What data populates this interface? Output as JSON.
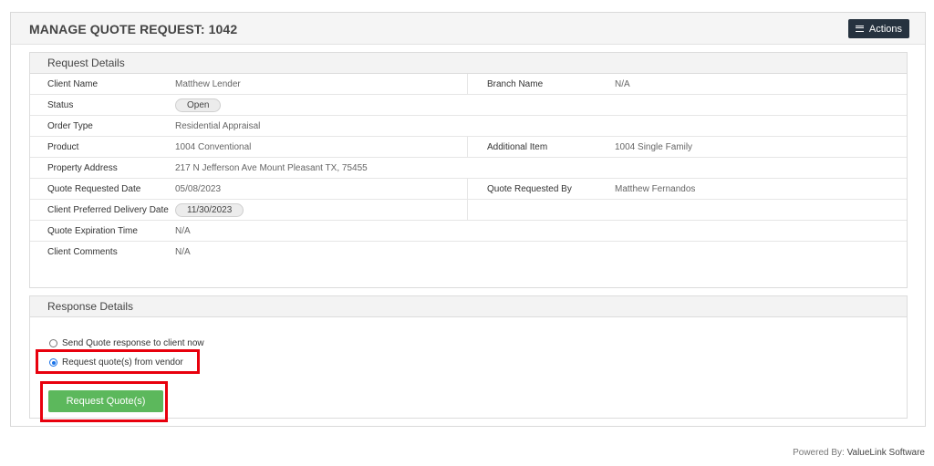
{
  "header": {
    "title": "MANAGE QUOTE REQUEST: 1042",
    "actions_label": "Actions"
  },
  "request_details": {
    "title": "Request Details",
    "rows": [
      {
        "label": "Client Name",
        "value": "Matthew Lender",
        "label2": "Branch Name",
        "value2": "N/A"
      },
      {
        "label": "Status",
        "value": "Open"
      },
      {
        "label": "Order Type",
        "value": "Residential Appraisal"
      },
      {
        "label": "Product",
        "value": "1004 Conventional",
        "label2": "Additional Item",
        "value2": "1004 Single Family"
      },
      {
        "label": "Property Address",
        "value": "217 N Jefferson Ave Mount Pleasant TX, 75455"
      },
      {
        "label": "Quote Requested Date",
        "value": "05/08/2023",
        "label2": "Quote Requested By",
        "value2": "Matthew Fernandos"
      },
      {
        "label": "Client Preferred Delivery Date",
        "value": "11/30/2023"
      },
      {
        "label": "Quote Expiration Time",
        "value": "N/A"
      },
      {
        "label": "Client Comments",
        "value": "N/A"
      }
    ]
  },
  "response_details": {
    "title": "Response Details",
    "option_send": "Send Quote response to client now",
    "option_request": "Request quote(s) from vendor",
    "selected": "request",
    "button_label": "Request Quote(s)"
  },
  "footer": {
    "prefix": "Powered By: ",
    "brand": "ValueLink Software"
  },
  "colors": {
    "highlight": "#e8000d",
    "button_green": "#5cb85c",
    "actions_dark": "#26323f"
  }
}
